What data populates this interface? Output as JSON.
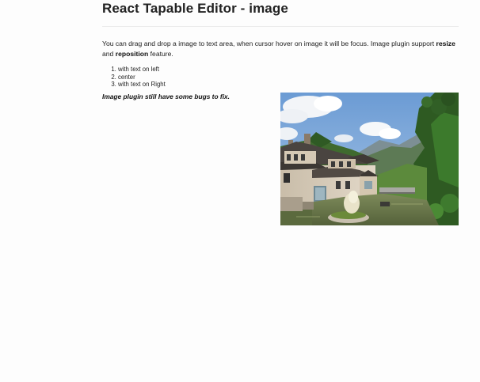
{
  "page": {
    "title": "React Tapable Editor - image"
  },
  "editor": {
    "intro": {
      "part1": "You can drag and drop a image to text area, when cursor hover on image it will be focus. Image plugin support ",
      "bold1": "resize",
      "part2": " and ",
      "bold2": "reposition",
      "part3": " feature."
    },
    "list": [
      "with text on left",
      "center",
      "with text on Right"
    ],
    "note": "Image plugin still have some bugs to fix.",
    "image": {
      "description": "photo"
    }
  },
  "colors": {
    "sky": "#7fa8d6",
    "cloud": "#f4f6f8",
    "mountain_green": "#3f6a2e",
    "water": "#6d7a4a",
    "roof": "#4a4440",
    "wall": "#d9cfc0"
  }
}
